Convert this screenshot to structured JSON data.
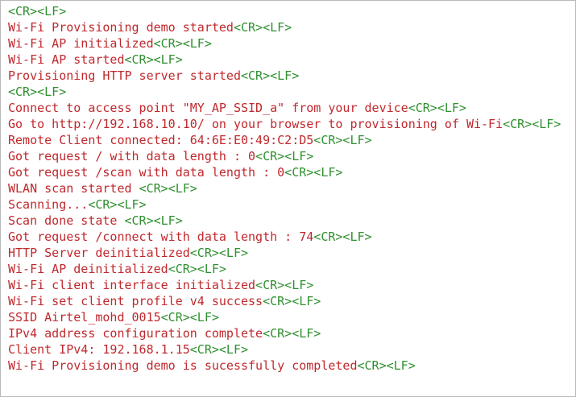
{
  "terminal": {
    "colors": {
      "message": "#c0282d",
      "line_ending": "#2f8f2f",
      "background": "#ffffff"
    },
    "line_ending_marker": "<CR><LF>",
    "lines": [
      {
        "text": ""
      },
      {
        "text": "Wi-Fi Provisioning demo started"
      },
      {
        "text": "Wi-Fi AP initialized"
      },
      {
        "text": "Wi-Fi AP started"
      },
      {
        "text": "Provisioning HTTP server started"
      },
      {
        "text": ""
      },
      {
        "text": "Connect to access point \"MY_AP_SSID_a\" from your device"
      },
      {
        "text": "Go to http://192.168.10.10/ on your browser to provisioning of Wi-Fi"
      },
      {
        "text": "Remote Client connected: 64:6E:E0:49:C2:D5"
      },
      {
        "text": "Got request / with data length : 0"
      },
      {
        "text": "Got request /scan with data length : 0"
      },
      {
        "text": "WLAN scan started "
      },
      {
        "text": "Scanning..."
      },
      {
        "text": "Scan done state "
      },
      {
        "text": "Got request /connect with data length : 74"
      },
      {
        "text": "HTTP Server deinitialized"
      },
      {
        "text": "Wi-Fi AP deinitialized"
      },
      {
        "text": "Wi-Fi client interface initialized"
      },
      {
        "text": "Wi-Fi set client profile v4 success"
      },
      {
        "text": "SSID Airtel_mohd_0015"
      },
      {
        "text": "IPv4 address configuration complete"
      },
      {
        "text": "Client IPv4: 192.168.1.15"
      },
      {
        "text": "Wi-Fi Provisioning demo is sucessfully completed"
      }
    ]
  }
}
